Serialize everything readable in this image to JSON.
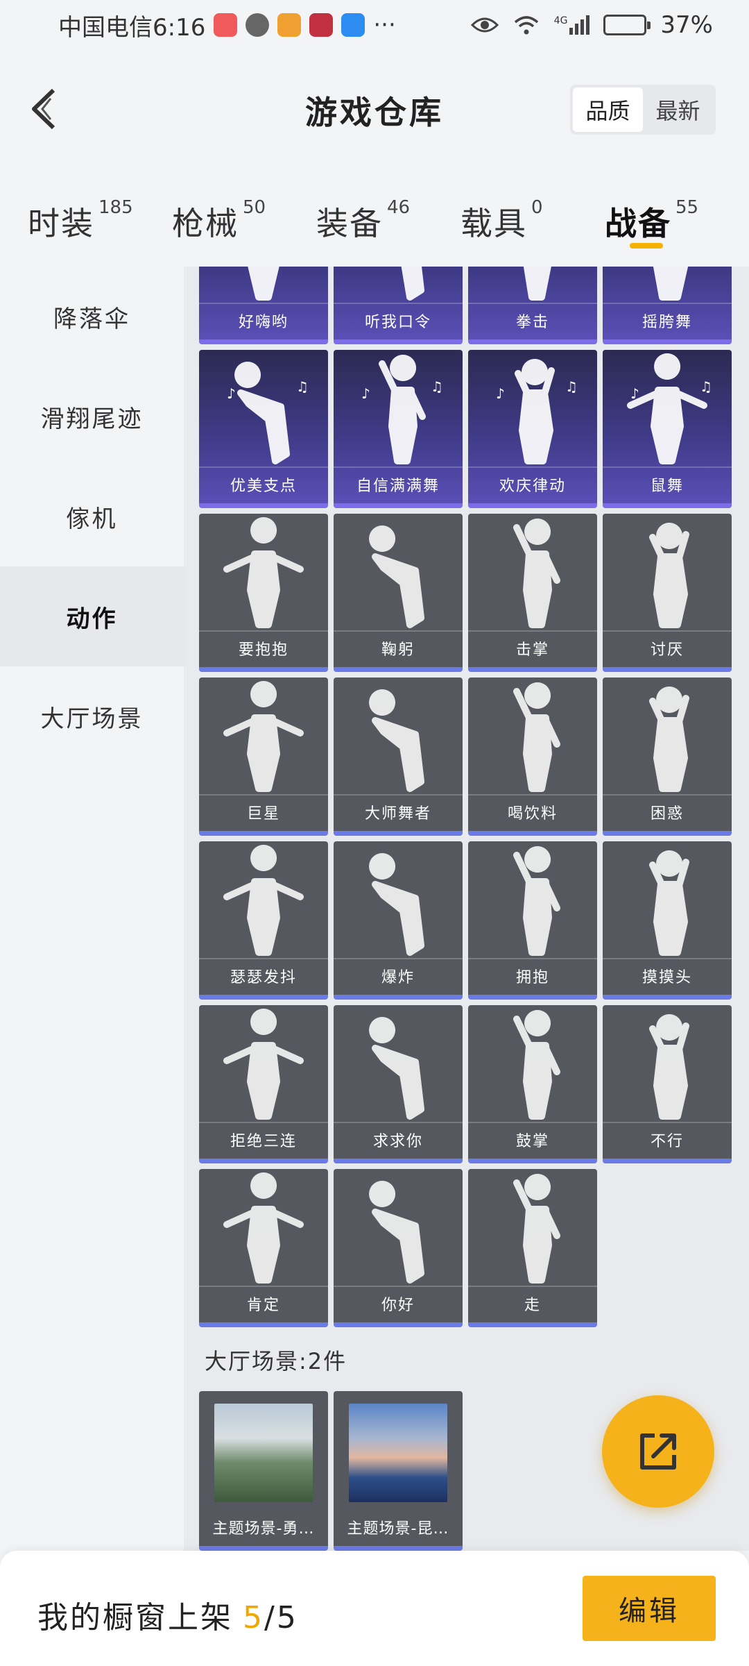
{
  "status_bar": {
    "carrier_time": "中国电信6:16",
    "more": "···",
    "network": "4G",
    "battery_percent": 0.37,
    "battery_text": "37%"
  },
  "header": {
    "title": "游戏仓库",
    "sort_options": [
      "品质",
      "最新"
    ],
    "sort_selected": "品质"
  },
  "tabs": [
    {
      "label": "时装",
      "count": "185"
    },
    {
      "label": "枪械",
      "count": "50"
    },
    {
      "label": "装备",
      "count": "46"
    },
    {
      "label": "载具",
      "count": "0"
    },
    {
      "label": "战备",
      "count": "55",
      "active": true
    }
  ],
  "sidebar": {
    "items": [
      "降落伞",
      "滑翔尾迹",
      "傢机",
      "动作",
      "大厅场景"
    ],
    "active": "动作"
  },
  "actions": {
    "partial_row": [
      "好嗨哟",
      "听我口令",
      "拳击",
      "摇胯舞"
    ],
    "purple_row": [
      "优美支点",
      "自信满满舞",
      "欢庆律动",
      "鼠舞"
    ],
    "gray_rows": [
      [
        "要抱抱",
        "鞠躬",
        "击掌",
        "讨厌"
      ],
      [
        "巨星",
        "大师舞者",
        "喝饮料",
        "困惑"
      ],
      [
        "瑟瑟发抖",
        "爆炸",
        "拥抱",
        "摸摸头"
      ],
      [
        "拒绝三连",
        "求求你",
        "鼓掌",
        "不行"
      ],
      [
        "肯定",
        "你好",
        "走"
      ]
    ]
  },
  "scenes": {
    "heading": "大厅场景:2件",
    "items": [
      "主题场景-勇…",
      "主题场景-昆…"
    ]
  },
  "bottom_bar": {
    "shelf_label": "我的橱窗上架",
    "shelf_count": "5",
    "shelf_total": "/5",
    "edit_label": "编辑"
  },
  "colors": {
    "accent": "#f6b21a",
    "card_gray": "#55585f",
    "card_purple": "#3f3a86",
    "card_strip": "#6b7be6"
  }
}
